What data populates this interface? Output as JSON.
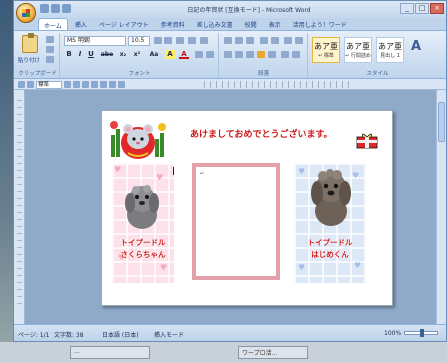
{
  "window": {
    "title": "日記の年賀状 [互換モード] - Microsoft Word",
    "controls": [
      "_",
      "□",
      "×"
    ]
  },
  "ribbon_tabs": [
    "ホーム",
    "挿入",
    "ページ レイアウト",
    "参考資料",
    "差し込み文書",
    "校閲",
    "表示",
    "活用しよう！ワード"
  ],
  "active_tab": "ホーム",
  "clipboard": {
    "paste_label": "貼り付け",
    "group_label": "クリップボード"
  },
  "font": {
    "family": "MS 明朝",
    "size": "10.5",
    "group_label": "フォント",
    "buttons": [
      "B",
      "I",
      "U",
      "abe",
      "x₂",
      "x²",
      "Aa",
      "A",
      "A"
    ]
  },
  "paragraph": {
    "group_label": "段落"
  },
  "styles": {
    "group_label": "スタイル",
    "items": [
      {
        "sample": "あア亜",
        "name": "↵ 標準",
        "selected": true
      },
      {
        "sample": "あア亜",
        "name": "↵ 行間詰め",
        "selected": false
      },
      {
        "sample": "あア亜",
        "name": "見出し 1",
        "selected": false
      }
    ]
  },
  "toolbar2": {
    "style_combo": "標準"
  },
  "document": {
    "greeting": "あけましておめでとうございます。",
    "left_dog": {
      "line1": "トイプードル",
      "line2": "さくらちゃん"
    },
    "right_dog": {
      "line1": "トイプードル",
      "line2": "はじめくん"
    },
    "frame_mark": "↵"
  },
  "status": {
    "page": "ページ: 1/1",
    "words": "文字数: 38",
    "language": "日本語 (日本)",
    "mode": "挿入モード",
    "zoom": "100%"
  },
  "taskbar": {
    "items": [
      "...",
      "ワープロ活..."
    ]
  }
}
